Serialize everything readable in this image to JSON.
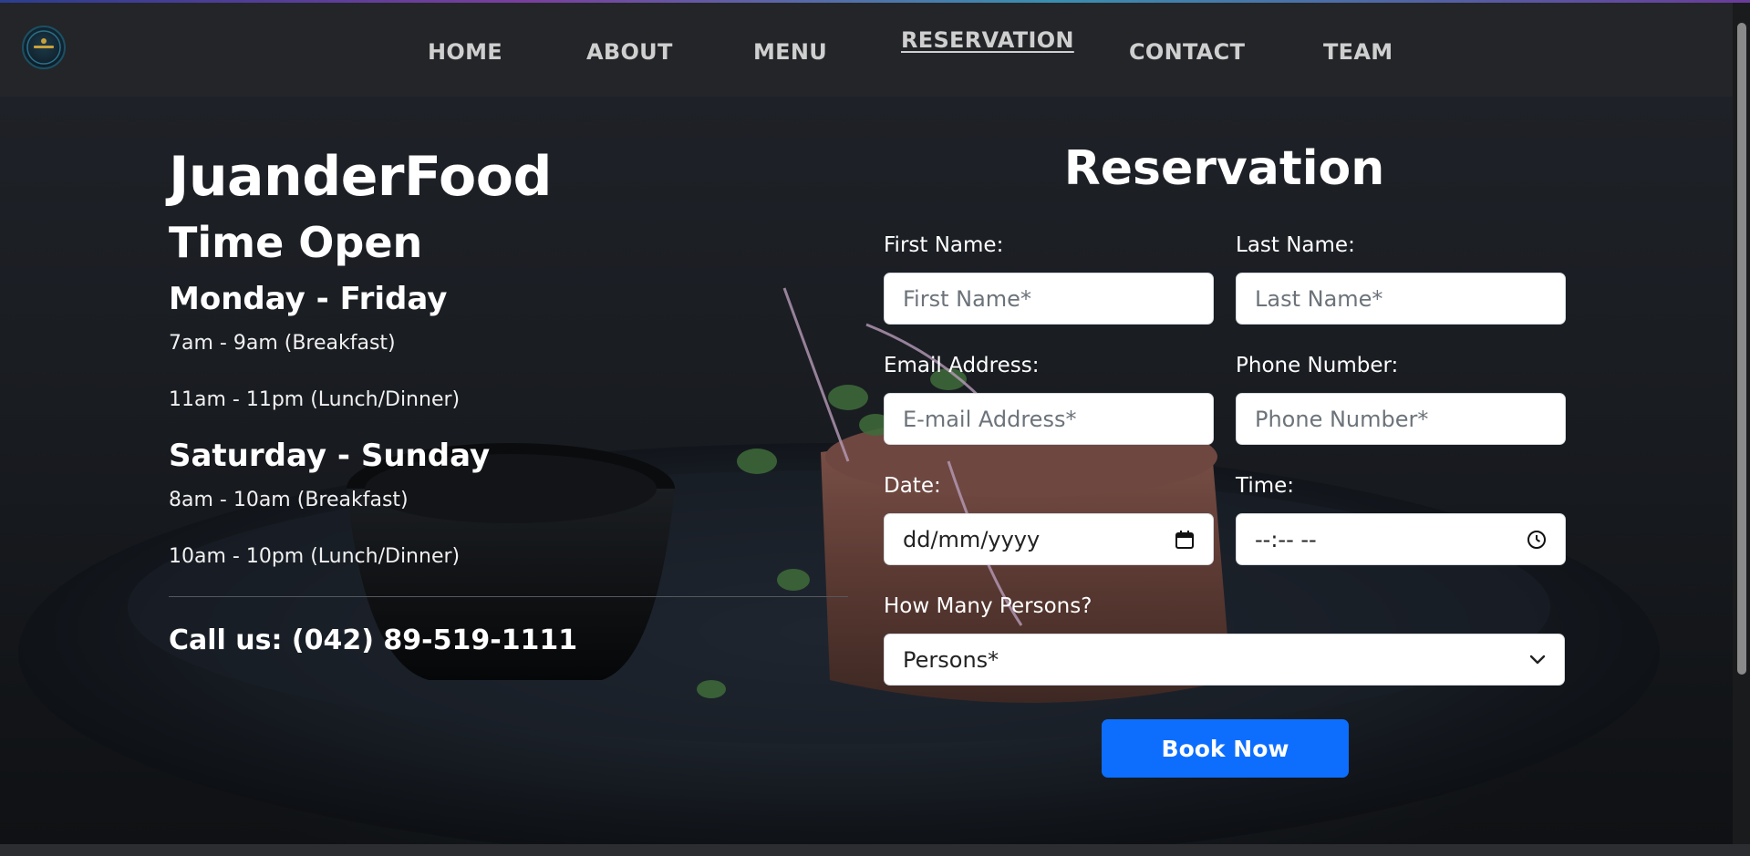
{
  "nav": {
    "logo_icon": "juanderfood-logo",
    "items": [
      {
        "label": "HOME",
        "active": false
      },
      {
        "label": "ABOUT",
        "active": false
      },
      {
        "label": "MENU",
        "active": false
      },
      {
        "label": "RESERVATION",
        "active": true
      },
      {
        "label": "CONTACT",
        "active": false
      },
      {
        "label": "TEAM",
        "active": false
      }
    ]
  },
  "info": {
    "brand": "JuanderFood",
    "hours_title": "Time Open",
    "weekday": {
      "range": "Monday - Friday",
      "times": [
        "7am - 9am (Breakfast)",
        "11am - 11pm (Lunch/Dinner)"
      ]
    },
    "weekend": {
      "range": "Saturday - Sunday",
      "times": [
        "8am - 10am (Breakfast)",
        "10am - 10pm (Lunch/Dinner)"
      ]
    },
    "call": "Call us: (042) 89-519-1111"
  },
  "form": {
    "title": "Reservation",
    "first_name": {
      "label": "First Name:",
      "placeholder": "First Name*"
    },
    "last_name": {
      "label": "Last Name:",
      "placeholder": "Last Name*"
    },
    "email": {
      "label": "Email Address:",
      "placeholder": "E-mail Address*"
    },
    "phone": {
      "label": "Phone Number:",
      "placeholder": "Phone Number*"
    },
    "date": {
      "label": "Date:",
      "value": "dd/mm/yyyy",
      "icon": "calendar-icon"
    },
    "time": {
      "label": "Time:",
      "value": "--:-- --",
      "icon": "clock-icon"
    },
    "persons": {
      "label": "How Many Persons?",
      "selected": "Persons*",
      "icon": "chevron-down-icon"
    },
    "submit_label": "Book Now"
  },
  "colors": {
    "navbar_bg": "#232528",
    "button_primary": "#0d6efd",
    "text_primary": "#ffffff",
    "nav_text": "#cfcfcf"
  }
}
